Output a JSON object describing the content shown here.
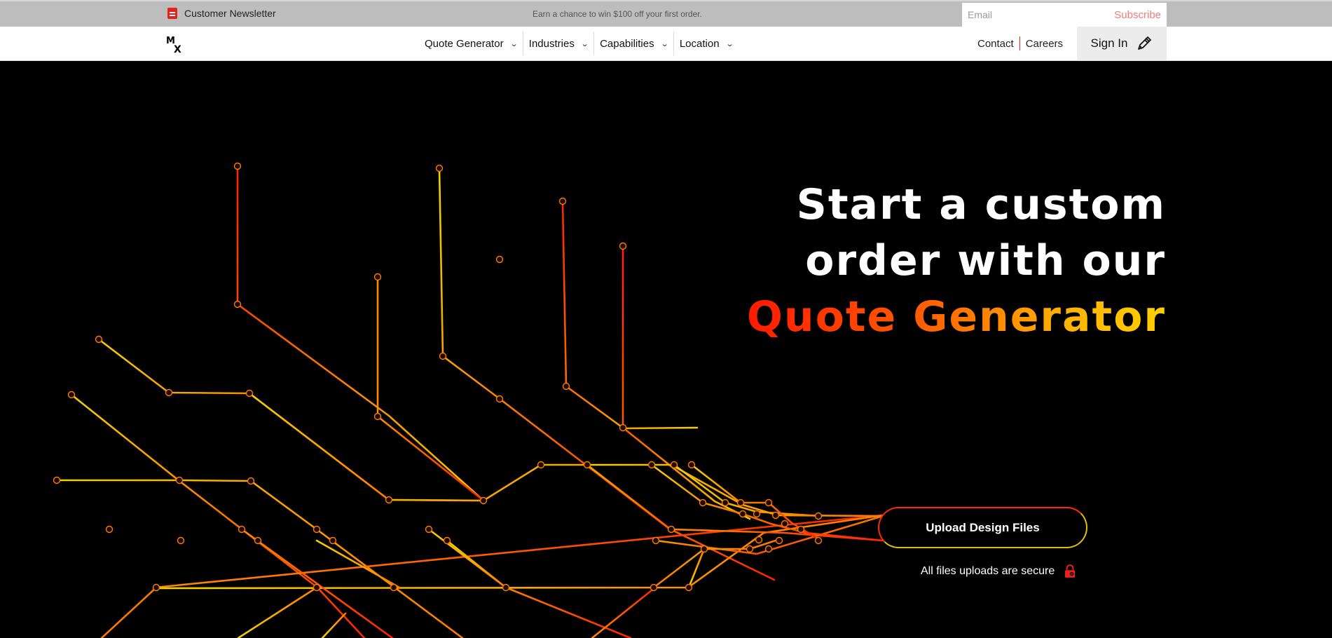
{
  "topbar": {
    "newsletter_label": "Customer Newsletter",
    "newsletter_icon": "newsletter-icon",
    "promo_text": "Earn a chance to win $100 off your first order.",
    "email_placeholder": "Email",
    "subscribe_label": "Subscribe"
  },
  "nav": {
    "logo_text": "MX",
    "items": [
      {
        "label": "Quote Generator"
      },
      {
        "label": "Industries"
      },
      {
        "label": "Capabilities"
      },
      {
        "label": "Location"
      }
    ],
    "contact_label": "Contact",
    "careers_label": "Careers",
    "signin_label": "Sign In",
    "signin_icon": "pen-icon"
  },
  "hero": {
    "heading_line1": "Start a custom",
    "heading_line2": "order with our",
    "heading_accent": "Quote Generator",
    "upload_label": "Upload Design Files",
    "secure_text": "All files uploads are secure",
    "secure_icon": "lock-icon"
  },
  "colors": {
    "accent_red": "#ff1a00",
    "accent_orange": "#ff6a00",
    "accent_yellow": "#f0d000",
    "background": "#000000"
  }
}
